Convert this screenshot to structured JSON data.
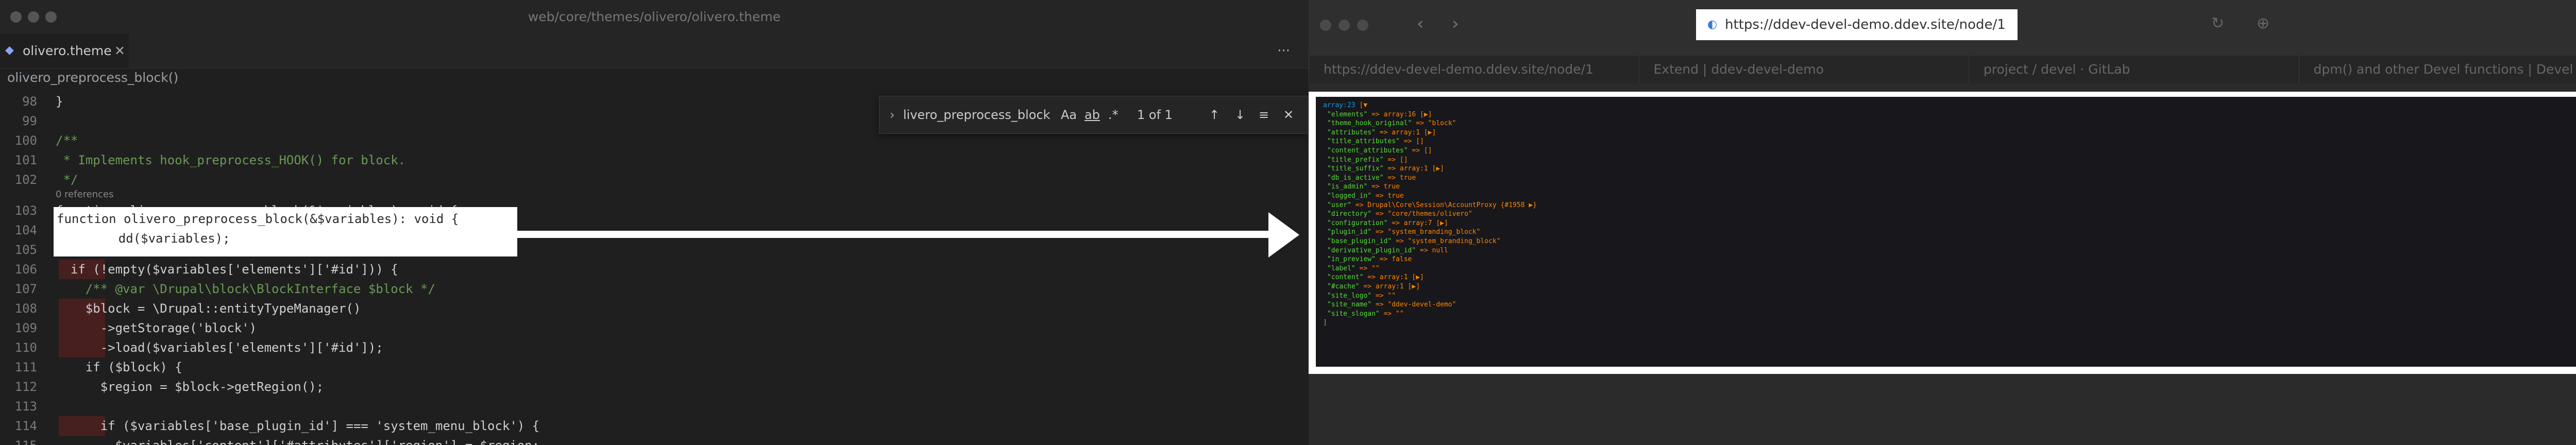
{
  "editor": {
    "window_title": "web/core/themes/olivero/olivero.theme",
    "tab_label": "olivero.theme",
    "tab_close": "✕",
    "more": "···",
    "breadcrumb": "olivero_preprocess_block()",
    "references": "0 references",
    "find": {
      "query": "livero_preprocess_block",
      "opt_case": "Aa",
      "opt_word": "ab",
      "opt_regex": ".*",
      "result": "1 of 1"
    },
    "lines": [
      {
        "n": "98",
        "t": "}"
      },
      {
        "n": "99",
        "t": ""
      },
      {
        "n": "100",
        "t": "/**"
      },
      {
        "n": "101",
        "t": " * Implements hook_preprocess_HOOK() for block."
      },
      {
        "n": "102",
        "t": " */"
      },
      {
        "n": "103",
        "t": "function olivero_preprocess_block(&$variables): void {"
      },
      {
        "n": "104",
        "t": "    dd($variables);"
      },
      {
        "n": "105",
        "t": ""
      },
      {
        "n": "106",
        "t": "  if (!empty($variables['elements']['#id'])) {"
      },
      {
        "n": "107",
        "t": "    /** @var \\Drupal\\block\\BlockInterface $block */"
      },
      {
        "n": "108",
        "t": "    $block = \\Drupal::entityTypeManager()"
      },
      {
        "n": "109",
        "t": "      ->getStorage('block')"
      },
      {
        "n": "110",
        "t": "      ->load($variables['elements']['#id']);"
      },
      {
        "n": "111",
        "t": "    if ($block) {"
      },
      {
        "n": "112",
        "t": "      $region = $block->getRegion();"
      },
      {
        "n": "113",
        "t": ""
      },
      {
        "n": "114",
        "t": "      if ($variables['base_plugin_id'] === 'system_menu_block') {"
      },
      {
        "n": "115",
        "t": "        $variables['content']['#attributes']['region'] = $region;"
      }
    ]
  },
  "browser": {
    "url": "https://ddev-devel-demo.ddev.site/node/1",
    "tabs": [
      "https://ddev-devel-demo.ddev.site/node/1",
      "Extend | ddev-devel-demo",
      "project / devel · GitLab",
      "dpm() and other Devel functions | Devel |..."
    ],
    "dump": [
      {
        "k": "array:23",
        "v": "[▼"
      },
      {
        "k": "\"elements\"",
        "v": "=> array:16 [▶]"
      },
      {
        "k": "\"theme_hook_original\"",
        "v": "=> \"block\""
      },
      {
        "k": "\"attributes\"",
        "v": "=> array:1 [▶]"
      },
      {
        "k": "\"title_attributes\"",
        "v": "=> []"
      },
      {
        "k": "\"content_attributes\"",
        "v": "=> []"
      },
      {
        "k": "\"title_prefix\"",
        "v": "=> []"
      },
      {
        "k": "\"title_suffix\"",
        "v": "=> array:1 [▶]"
      },
      {
        "k": "\"db_is_active\"",
        "v": "=> true"
      },
      {
        "k": "\"is_admin\"",
        "v": "=> true"
      },
      {
        "k": "\"logged_in\"",
        "v": "=> true"
      },
      {
        "k": "\"user\"",
        "v": "=> Drupal\\Core\\Session\\AccountProxy {#1958 ▶}"
      },
      {
        "k": "\"directory\"",
        "v": "=> \"core/themes/olivero\""
      },
      {
        "k": "\"configuration\"",
        "v": "=> array:7 [▶]"
      },
      {
        "k": "\"plugin_id\"",
        "v": "=> \"system_branding_block\""
      },
      {
        "k": "\"base_plugin_id\"",
        "v": "=> \"system_branding_block\""
      },
      {
        "k": "\"derivative_plugin_id\"",
        "v": "=> null"
      },
      {
        "k": "\"in_preview\"",
        "v": "=> false"
      },
      {
        "k": "\"label\"",
        "v": "=> \"\""
      },
      {
        "k": "\"content\"",
        "v": "=> array:1 [▶]"
      },
      {
        "k": "\"#cache\"",
        "v": "=> array:1 [▶]"
      },
      {
        "k": "\"site_logo\"",
        "v": "=> \"\""
      },
      {
        "k": "\"site_name\"",
        "v": "=> \"ddev-devel-demo\""
      },
      {
        "k": "\"site_slogan\"",
        "v": "=> \"\""
      },
      {
        "k": "]",
        "v": ""
      }
    ]
  },
  "colors": {
    "annotation": "#ffffff",
    "editor_bg": "#1f1f1f",
    "dump_bg": "#18171b"
  }
}
